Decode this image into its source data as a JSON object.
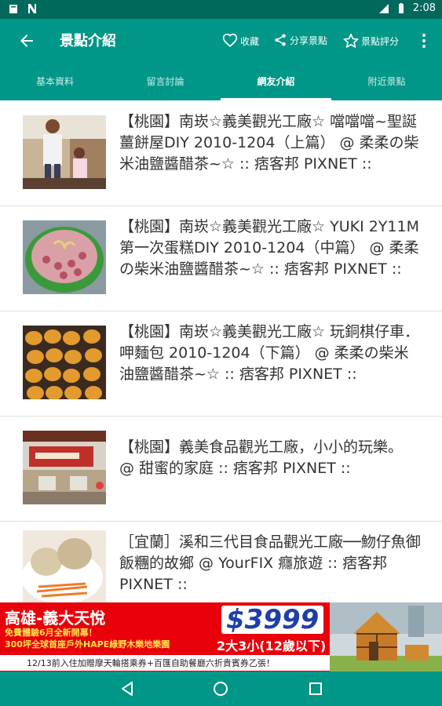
{
  "status_bar": {
    "time": "2:08",
    "icons": [
      "notification-icon",
      "n-icon",
      "signal-icon",
      "battery-icon"
    ]
  },
  "app_bar": {
    "title": "景點介紹",
    "actions": {
      "favorite": "收藏",
      "share": "分享景點",
      "rate": "景點評分"
    }
  },
  "tabs": [
    {
      "label": "基本資料",
      "active": false
    },
    {
      "label": "留言討論",
      "active": false
    },
    {
      "label": "網友介紹",
      "active": true
    },
    {
      "label": "附近景點",
      "active": false
    }
  ],
  "articles": [
    {
      "text": "【桃園】南崁☆義美觀光工廠☆ 噹噹噹~聖誕薑餅屋DIY 2010-1204（上篇） @ 柔柔の柴米油鹽醬醋茶~☆ :: 痞客邦 PIXNET ::"
    },
    {
      "text": "【桃園】南崁☆義美觀光工廠☆ YUKI 2Y11M 第一次蛋糕DIY 2010-1204（中篇） @ 柔柔の柴米油鹽醬醋茶~☆ :: 痞客邦 PIXNET ::"
    },
    {
      "text": "【桃園】南崁☆義美觀光工廠☆ 玩銅棋仔車．呷麵包 2010-1204（下篇） @ 柔柔の柴米油鹽醬醋茶~☆ :: 痞客邦 PIXNET ::"
    },
    {
      "text": "【桃園】義美食品觀光工廠，小小的玩樂。 @ 甜蜜的家庭 :: 痞客邦 PIXNET ::"
    },
    {
      "text": "［宜蘭］溪和三代目食品觀光工廠──魩仔魚御飯糰的故鄉 @ YourFIX 癮旅遊 :: 痞客邦 PIXNET ::"
    }
  ],
  "ad": {
    "title": "高雄-義大天悅",
    "line1": "免費體驗6月全新開幕！",
    "line2": "300坪全球首座戶外HAPE綠野木樂地樂園",
    "price": "$3999",
    "price_note": "2大3小(12歲以下)",
    "footer": "12/13前入住加贈摩天輪搭乘券+百匯自助餐廳六折貴賓券乙張！"
  },
  "colors": {
    "primary": "#009688",
    "primary_dark": "#00695c",
    "ad_red": "#e8000b"
  }
}
